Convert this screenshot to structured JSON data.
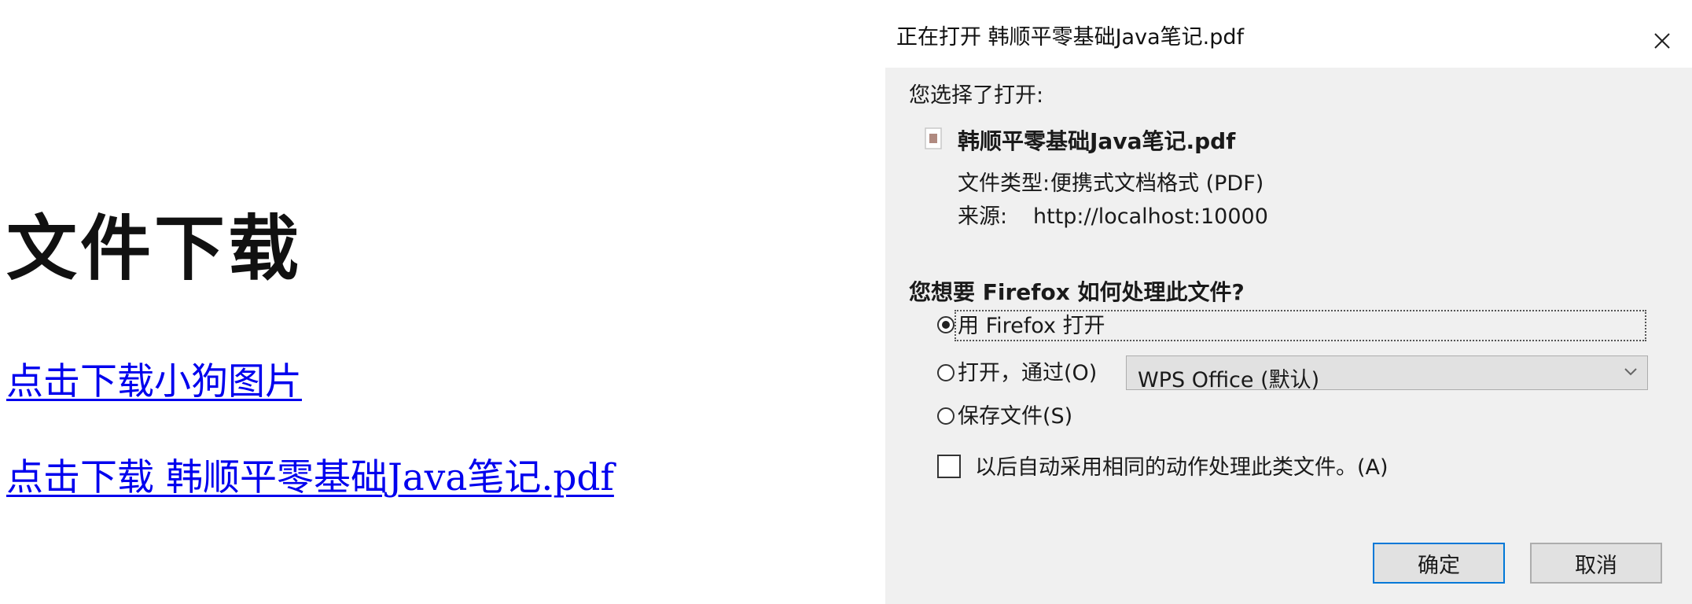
{
  "page": {
    "title": "文件下载",
    "links": [
      "点击下载小狗图片",
      "点击下载 韩顺平零基础Java笔记.pdf"
    ]
  },
  "dialog": {
    "title": "正在打开 韩顺平零基础Java笔记.pdf",
    "chosen_label": "您选择了打开:",
    "file_name": "韩顺平零基础Java笔记.pdf",
    "file_type_label": "文件类型:",
    "file_type_value": "便携式文档格式 (PDF)",
    "source_label": "来源:",
    "source_value": "http://localhost:10000",
    "question": "您想要 Firefox 如何处理此文件?",
    "options": [
      {
        "label": "用 Firefox 打开",
        "checked": true
      },
      {
        "label": "打开，通过(O)",
        "checked": false
      },
      {
        "label": "保存文件(S)",
        "checked": false
      }
    ],
    "open_with_selected": "WPS Office (默认)",
    "remember_label": "以后自动采用相同的动作处理此类文件。(A)",
    "remember_checked": false,
    "ok_label": "确定",
    "cancel_label": "取消"
  }
}
